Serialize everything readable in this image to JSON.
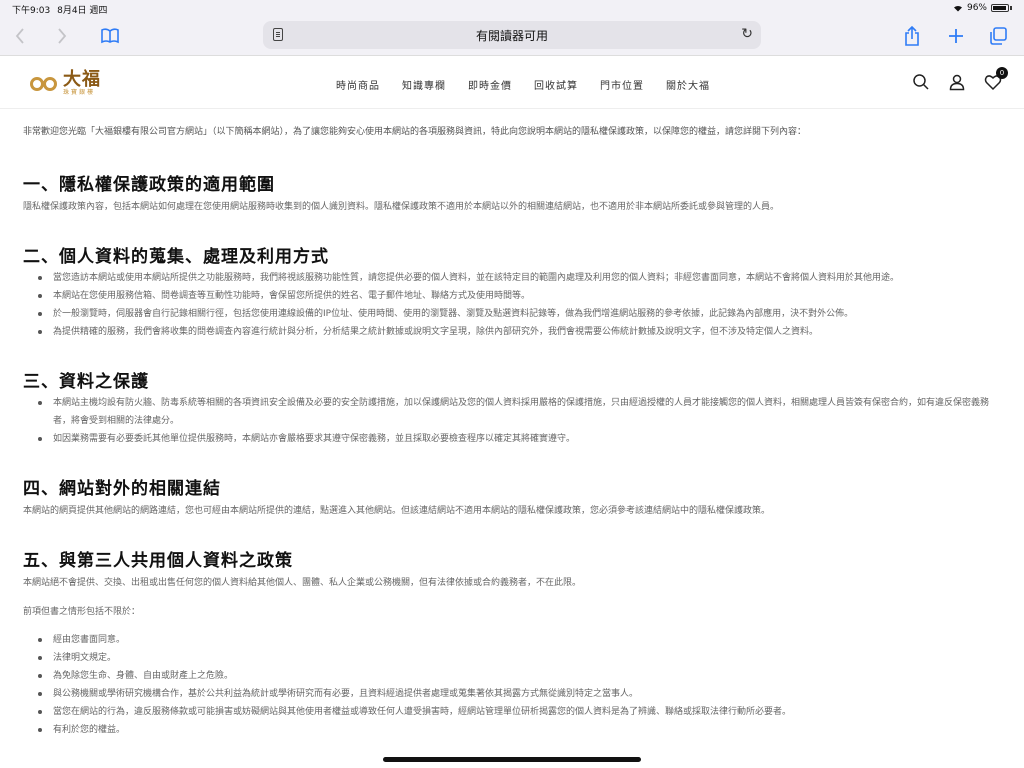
{
  "status_bar": {
    "time": "下午9:03",
    "date": "8月4日 週四",
    "battery": "96%"
  },
  "browser": {
    "address_text": "有閱讀器可用"
  },
  "site": {
    "logo_main": "大福",
    "logo_sub": "珠寶銀樓",
    "nav": [
      "時尚商品",
      "知識專欄",
      "即時金價",
      "回收試算",
      "門市位置",
      "關於大福"
    ],
    "cart_count": "0"
  },
  "content": {
    "intro": "非常歡迎您光臨「大福銀樓有限公司官方網站」（以下簡稱本網站），為了讓您能夠安心使用本網站的各項服務與資訊，特此向您說明本網站的隱私權保護政策，以保障您的權益，請您詳閱下列內容：",
    "s1": {
      "title": "一、隱私權保護政策的適用範圍",
      "para": "隱私權保護政策內容，包括本網站如何處理在您使用網站服務時收集到的個人識別資料。隱私權保護政策不適用於本網站以外的相關連結網站，也不適用於非本網站所委託或參與管理的人員。"
    },
    "s2": {
      "title": "二、個人資料的蒐集、處理及利用方式",
      "items": [
        "當您造訪本網站或使用本網站所提供之功能服務時，我們將視該服務功能性質，請您提供必要的個人資料，並在該特定目的範圍內處理及利用您的個人資料；非經您書面同意，本網站不會將個人資料用於其他用途。",
        "本網站在您使用服務信箱、問卷調查等互動性功能時，會保留您所提供的姓名、電子郵件地址、聯絡方式及使用時間等。",
        "於一般瀏覽時，伺服器會自行記錄相關行徑，包括您使用連線設備的IP位址、使用時間、使用的瀏覽器、瀏覽及點選資料記錄等，做為我們增進網站服務的參考依據，此記錄為內部應用，決不對外公佈。",
        "為提供精確的服務，我們會將收集的問卷調查內容進行統計與分析，分析結果之統計數據或說明文字呈現，除供內部研究外，我們會視需要公佈統計數據及說明文字，但不涉及特定個人之資料。"
      ]
    },
    "s3": {
      "title": "三、資料之保護",
      "items": [
        "本網站主機均設有防火牆、防毒系統等相關的各項資訊安全設備及必要的安全防護措施，加以保護網站及您的個人資料採用嚴格的保護措施，只由經過授權的人員才能接觸您的個人資料，相關處理人員皆簽有保密合約，如有違反保密義務者，將會受到相關的法律處分。",
        "如因業務需要有必要委託其他單位提供服務時，本網站亦會嚴格要求其遵守保密義務，並且採取必要檢查程序以確定其將確實遵守。"
      ]
    },
    "s4": {
      "title": "四、網站對外的相關連結",
      "para": "本網站的網頁提供其他網站的網路連結，您也可經由本網站所提供的連結，點選進入其他網站。但該連結網站不適用本網站的隱私權保護政策，您必須參考該連結網站中的隱私權保護政策。"
    },
    "s5": {
      "title": "五、與第三人共用個人資料之政策",
      "para": "本網站絕不會提供、交換、出租或出售任何您的個人資料給其他個人、團體、私人企業或公務機關，但有法律依據或合約義務者，不在此限。",
      "sub": "前項但書之情形包括不限於：",
      "items": [
        "經由您書面同意。",
        "法律明文規定。",
        "為免除您生命、身體、自由或財產上之危險。",
        "與公務機關或學術研究機構合作，基於公共利益為統計或學術研究而有必要，且資料經過提供者處理或蒐集著依其揭露方式無從識別特定之當事人。",
        "當您在網站的行為，違反服務條款或可能損害或妨礙網站與其他使用者權益或導致任何人遭受損害時，經網站管理單位研析揭露您的個人資料是為了辨識、聯絡或採取法律行動所必要者。",
        "有利於您的權益。"
      ]
    }
  }
}
